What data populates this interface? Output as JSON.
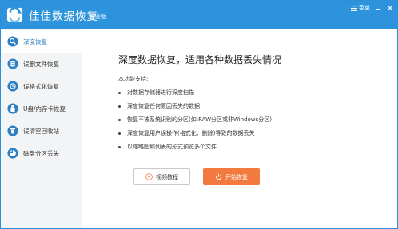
{
  "app": {
    "title": "佳佳数据恢复",
    "edition": "专业版",
    "brand_color": "#2d93dd"
  },
  "window_controls": {
    "menu_label": "菜单"
  },
  "sidebar": {
    "items": [
      {
        "label": "深度恢复",
        "icon": "search-disk-icon",
        "active": true
      },
      {
        "label": "误删文件恢复",
        "icon": "file-icon",
        "active": false
      },
      {
        "label": "误格式化恢复",
        "icon": "format-disk-icon",
        "active": false
      },
      {
        "label": "U盘/内存卡恢复",
        "icon": "usb-icon",
        "active": false
      },
      {
        "label": "误清空回收站",
        "icon": "recycle-bin-icon",
        "active": false
      },
      {
        "label": "磁盘分区丢失",
        "icon": "partition-icon",
        "active": false
      }
    ]
  },
  "main": {
    "heading": "深度数据恢复，适用各种数据丢失情况",
    "features_title": "本功能支持:",
    "features": [
      "对数据存储器进行深度扫描",
      "深度恢复任何原因丢失的数据",
      "恢复不被系统识别的分区(如:RAW分区或非Windows分区)",
      "深度恢复用户误操作(格式化、删除)导致的数据丢失",
      "以缩略图和列表的形式预览多个文件"
    ],
    "video_button": "视频教程",
    "start_button": "开始恢复",
    "accent_color": "#f27a3f"
  }
}
